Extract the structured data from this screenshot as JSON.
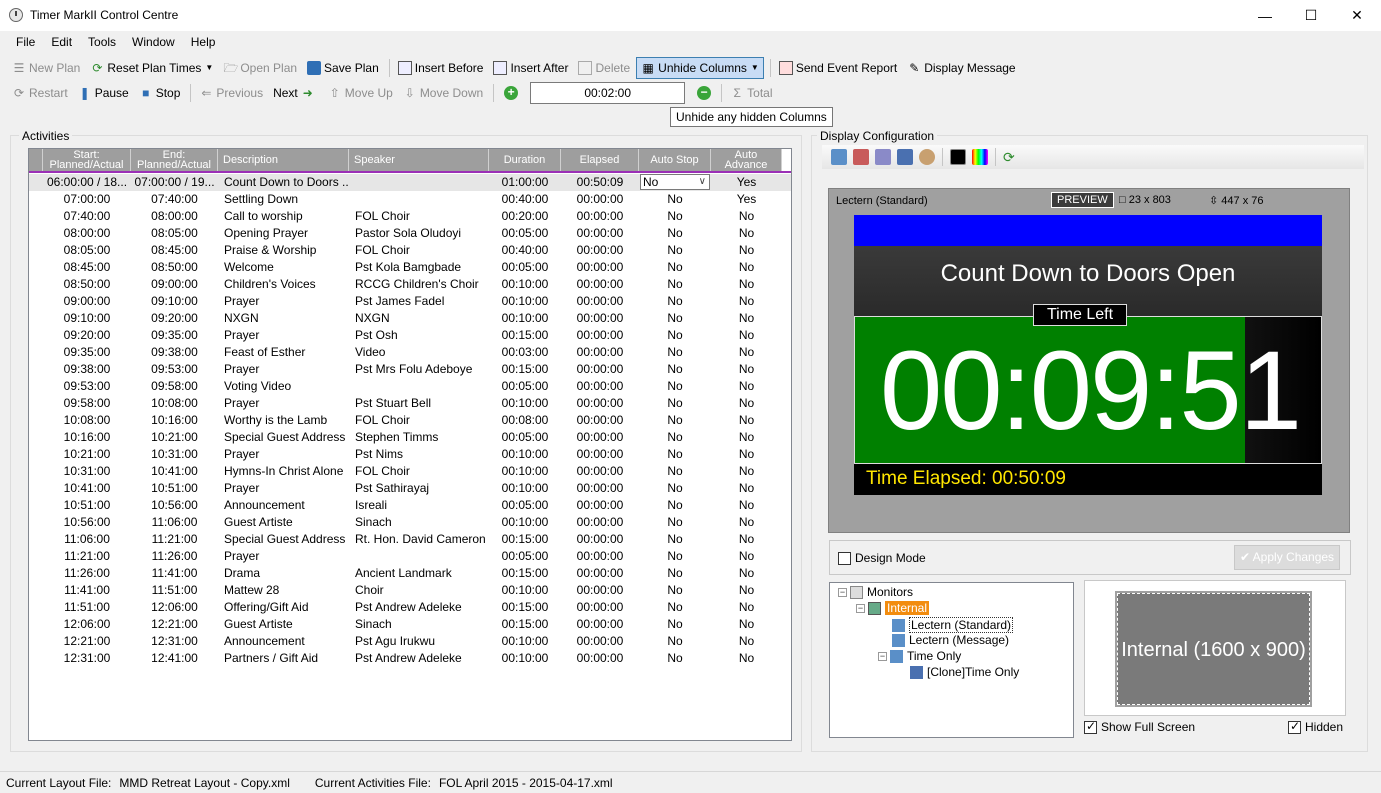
{
  "window": {
    "title": "Timer MarkII Control Centre",
    "minimize": "—",
    "maximize": "☐",
    "close": "✕"
  },
  "menu": [
    "File",
    "Edit",
    "Tools",
    "Window",
    "Help"
  ],
  "toolbar1": {
    "new_plan": "New Plan",
    "reset_plan_times": "Reset Plan Times",
    "open_plan": "Open Plan",
    "save_plan": "Save Plan",
    "insert_before": "Insert Before",
    "insert_after": "Insert After",
    "delete": "Delete",
    "unhide_columns": "Unhide Columns",
    "send_event_report": "Send Event Report",
    "display_message": "Display Message"
  },
  "toolbar2": {
    "restart": "Restart",
    "pause": "Pause",
    "stop": "Stop",
    "previous": "Previous",
    "next": "Next",
    "move_up": "Move Up",
    "move_down": "Move Down",
    "time_value": "00:02:00",
    "total": "Total"
  },
  "tooltip": "Unhide any hidden Columns",
  "activities": {
    "label": "Activities",
    "headers": {
      "start": "Start:\nPlanned/Actual",
      "end": "End:\nPlanned/Actual",
      "description": "Description",
      "speaker": "Speaker",
      "duration": "Duration",
      "elapsed": "Elapsed",
      "auto_stop": "Auto Stop",
      "auto_advance": "Auto\nAdvance"
    },
    "rows": [
      [
        "06:00:00 / 18...",
        "07:00:00 / 19...",
        "Count Down to Doors ...",
        "",
        "01:00:00",
        "00:50:09",
        "No",
        "Yes"
      ],
      [
        "07:00:00",
        "07:40:00",
        "Settling Down",
        "",
        "00:40:00",
        "00:00:00",
        "No",
        "Yes"
      ],
      [
        "07:40:00",
        "08:00:00",
        "Call to worship",
        "FOL Choir",
        "00:20:00",
        "00:00:00",
        "No",
        "No"
      ],
      [
        "08:00:00",
        "08:05:00",
        "Opening Prayer",
        "Pastor Sola Oludoyi",
        "00:05:00",
        "00:00:00",
        "No",
        "No"
      ],
      [
        "08:05:00",
        "08:45:00",
        "Praise & Worship",
        "FOL Choir",
        "00:40:00",
        "00:00:00",
        "No",
        "No"
      ],
      [
        "08:45:00",
        "08:50:00",
        "Welcome",
        "Pst Kola Bamgbade",
        "00:05:00",
        "00:00:00",
        "No",
        "No"
      ],
      [
        "08:50:00",
        "09:00:00",
        "Children's Voices",
        "RCCG Children's Choir",
        "00:10:00",
        "00:00:00",
        "No",
        "No"
      ],
      [
        "09:00:00",
        "09:10:00",
        "Prayer",
        "Pst James Fadel",
        "00:10:00",
        "00:00:00",
        "No",
        "No"
      ],
      [
        "09:10:00",
        "09:20:00",
        "NXGN",
        "NXGN",
        "00:10:00",
        "00:00:00",
        "No",
        "No"
      ],
      [
        "09:20:00",
        "09:35:00",
        "Prayer",
        "Pst Osh",
        "00:15:00",
        "00:00:00",
        "No",
        "No"
      ],
      [
        "09:35:00",
        "09:38:00",
        "Feast of Esther",
        "Video",
        "00:03:00",
        "00:00:00",
        "No",
        "No"
      ],
      [
        "09:38:00",
        "09:53:00",
        "Prayer",
        "Pst Mrs Folu Adeboye",
        "00:15:00",
        "00:00:00",
        "No",
        "No"
      ],
      [
        "09:53:00",
        "09:58:00",
        "Voting Video",
        "",
        "00:05:00",
        "00:00:00",
        "No",
        "No"
      ],
      [
        "09:58:00",
        "10:08:00",
        "Prayer",
        "Pst Stuart Bell",
        "00:10:00",
        "00:00:00",
        "No",
        "No"
      ],
      [
        "10:08:00",
        "10:16:00",
        "Worthy is the Lamb",
        "FOL Choir",
        "00:08:00",
        "00:00:00",
        "No",
        "No"
      ],
      [
        "10:16:00",
        "10:21:00",
        "Special Guest Address",
        "Stephen Timms",
        "00:05:00",
        "00:00:00",
        "No",
        "No"
      ],
      [
        "10:21:00",
        "10:31:00",
        "Prayer",
        "Pst Nims",
        "00:10:00",
        "00:00:00",
        "No",
        "No"
      ],
      [
        "10:31:00",
        "10:41:00",
        "Hymns-In Christ Alone",
        "FOL Choir",
        "00:10:00",
        "00:00:00",
        "No",
        "No"
      ],
      [
        "10:41:00",
        "10:51:00",
        "Prayer",
        "Pst Sathirayaj",
        "00:10:00",
        "00:00:00",
        "No",
        "No"
      ],
      [
        "10:51:00",
        "10:56:00",
        "Announcement",
        "Isreali",
        "00:05:00",
        "00:00:00",
        "No",
        "No"
      ],
      [
        "10:56:00",
        "11:06:00",
        "Guest Artiste",
        "Sinach",
        "00:10:00",
        "00:00:00",
        "No",
        "No"
      ],
      [
        "11:06:00",
        "11:21:00",
        "Special Guest Address",
        "Rt. Hon. David Cameron",
        "00:15:00",
        "00:00:00",
        "No",
        "No"
      ],
      [
        "11:21:00",
        "11:26:00",
        "Prayer",
        "",
        "00:05:00",
        "00:00:00",
        "No",
        "No"
      ],
      [
        "11:26:00",
        "11:41:00",
        "Drama",
        "Ancient Landmark",
        "00:15:00",
        "00:00:00",
        "No",
        "No"
      ],
      [
        "11:41:00",
        "11:51:00",
        "Mattew 28",
        "Choir",
        "00:10:00",
        "00:00:00",
        "No",
        "No"
      ],
      [
        "11:51:00",
        "12:06:00",
        "Offering/Gift Aid",
        "Pst Andrew Adeleke",
        "00:15:00",
        "00:00:00",
        "No",
        "No"
      ],
      [
        "12:06:00",
        "12:21:00",
        "Guest Artiste",
        "Sinach",
        "00:15:00",
        "00:00:00",
        "No",
        "No"
      ],
      [
        "12:21:00",
        "12:31:00",
        "Announcement",
        "Pst Agu Irukwu",
        "00:10:00",
        "00:00:00",
        "No",
        "No"
      ],
      [
        "12:31:00",
        "12:41:00",
        "Partners / Gift Aid",
        "Pst Andrew Adeleke",
        "00:10:00",
        "00:00:00",
        "No",
        "No"
      ]
    ]
  },
  "display_config": {
    "label": "Display Configuration",
    "preview_name": "Lectern (Standard)",
    "preview_badge": "PREVIEW",
    "pos_text": "23 x 803",
    "size_text": "447 x 76",
    "screen_title": "Count Down to Doors Open",
    "time_left_label": "Time Left",
    "clock_main": "00:09:5",
    "clock_last": "1",
    "elapsed_text": "Time Elapsed: 00:50:09",
    "design_mode": "Design Mode",
    "apply_changes": "Apply Changes",
    "tree": {
      "monitors": "Monitors",
      "internal": "Internal",
      "lectern_standard": "Lectern (Standard)",
      "lectern_message": "Lectern (Message)",
      "time_only": "Time Only",
      "clone_time_only": "[Clone]Time Only"
    },
    "monitor_box": "Internal (1600 x 900)",
    "show_full_screen": "Show Full Screen",
    "hidden": "Hidden"
  },
  "status": {
    "layout_label": "Current Layout File:",
    "layout_value": "MMD Retreat Layout - Copy.xml",
    "activities_label": "Current Activities File:",
    "activities_value": "FOL April 2015 - 2015-04-17.xml"
  },
  "colors": {
    "accent": "#9b30b6",
    "green_panel": "#008000",
    "blue_bar": "#0000ff",
    "elapsed_yellow": "#ffe600",
    "tree_selected": "#f28c0f"
  }
}
